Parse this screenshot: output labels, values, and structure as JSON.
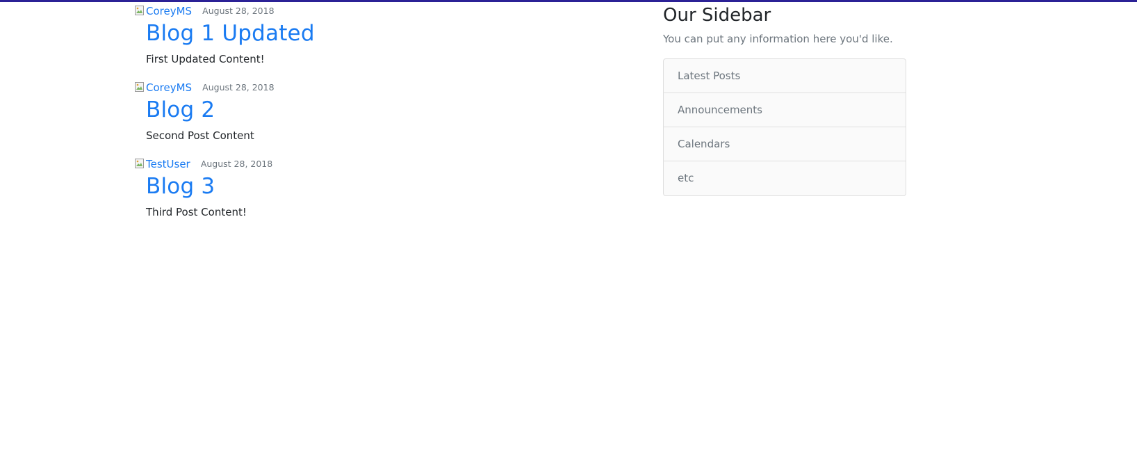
{
  "posts": [
    {
      "author": "CoreyMS",
      "date": "August 28, 2018",
      "title": "Blog 1 Updated",
      "content": "First Updated Content!"
    },
    {
      "author": "CoreyMS",
      "date": "August 28, 2018",
      "title": "Blog 2",
      "content": "Second Post Content"
    },
    {
      "author": "TestUser",
      "date": "August 28, 2018",
      "title": "Blog 3",
      "content": "Third Post Content!"
    }
  ],
  "sidebar": {
    "title": "Our Sidebar",
    "description": "You can put any information here you'd like.",
    "items": [
      "Latest Posts",
      "Announcements",
      "Calendars",
      "etc"
    ]
  },
  "colors": {
    "topbar": "#2b2196",
    "link": "#1a7bf2",
    "muted": "#6c757d",
    "text": "#212529"
  }
}
